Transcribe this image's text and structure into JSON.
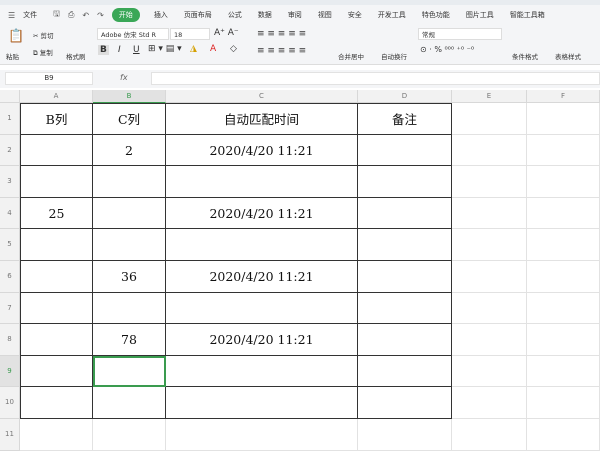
{
  "menu": {
    "file": "文件",
    "tabs": [
      "开始",
      "插入",
      "页面布局",
      "公式",
      "数据",
      "审阅",
      "视图",
      "安全",
      "开发工具",
      "特色功能",
      "图片工具",
      "智能工具箱"
    ],
    "active": "开始"
  },
  "ribbon": {
    "paste": "粘贴",
    "cut": "剪切",
    "copy": "复制",
    "format_painter": "格式刷",
    "font": "Adobe 仿宋 Std R",
    "size": "18",
    "bold": "B",
    "italic": "I",
    "underline": "U",
    "merge": "合并居中",
    "wrap": "自动换行",
    "number_format": "常规",
    "cond_format": "条件格式",
    "table_style": "表格样式"
  },
  "formula": {
    "name_box": "B9",
    "fx": "fx",
    "value": ""
  },
  "sheet": {
    "columns": [
      "A",
      "B",
      "C",
      "D",
      "E",
      "F"
    ],
    "selected_col": "B",
    "selected_row": 9,
    "rows": [
      {
        "n": "1",
        "cells": [
          "B列",
          "C列",
          "自动匹配时间",
          ""
        ]
      },
      {
        "n": "2",
        "cells": [
          "",
          "2",
          "2020/4/20 11:21",
          ""
        ]
      },
      {
        "n": "3",
        "cells": [
          "",
          "",
          "",
          ""
        ]
      },
      {
        "n": "4",
        "cells": [
          "25",
          "",
          "2020/4/20 11:21",
          ""
        ]
      },
      {
        "n": "5",
        "cells": [
          "",
          "",
          "",
          ""
        ]
      },
      {
        "n": "6",
        "cells": [
          "",
          "36",
          "2020/4/20 11:21",
          ""
        ]
      },
      {
        "n": "7",
        "cells": [
          "",
          "",
          "",
          ""
        ]
      },
      {
        "n": "8",
        "cells": [
          "",
          "78",
          "2020/4/20 11:21",
          ""
        ]
      },
      {
        "n": "9",
        "cells": [
          "",
          "",
          "",
          ""
        ]
      },
      {
        "n": "10",
        "cells": [
          "",
          "",
          "",
          ""
        ]
      },
      {
        "n": "11",
        "cells": [
          "",
          "",
          "",
          ""
        ]
      }
    ],
    "header_d": "备注"
  },
  "colors": {
    "accent": "#3aa757"
  }
}
